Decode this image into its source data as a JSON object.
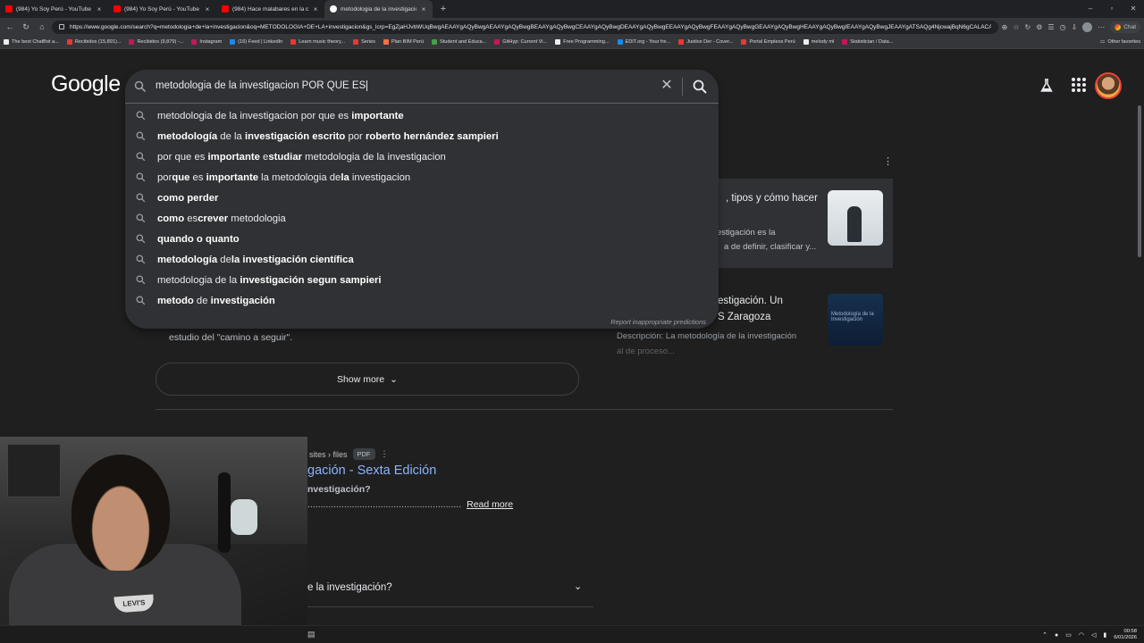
{
  "browser": {
    "tabs": [
      {
        "title": "(984) Yo Soy Perú - YouTube",
        "icon": "youtube-icon",
        "active": false
      },
      {
        "title": "(984) Yo Soy Perú - YouTube",
        "icon": "youtube-icon",
        "active": false
      },
      {
        "title": "(984) Hace malabares en la ca",
        "icon": "youtube-icon",
        "active": false
      },
      {
        "title": "metodologia de la investigacion",
        "icon": "google-icon",
        "active": true
      }
    ],
    "url": "https://www.google.com/search?q=metodologia+de+la+investigacion&oq=METODOLOGIA+DE+LA+investigacion&gs_lcrp=EgZjaHJvbWUqBwgAEAAYgAQyBwgAEAAYgAQyBwgBEAAYgAQyBwgCEAAYgAQyBwgDEAAYgAQyBwgEEAAYgAQyBwgFEAAYgAQyBwgGEAAYgAQyBwgHEAAYgAQyBwgIEAAYgAQyBwgJEAAYgATSAQg4NjcwajBqN6gCALACAA&sourceid=chrome&ie...",
    "chat_label": "Chat",
    "bookmarks": [
      "The best ChatBot a...",
      "Recibidos (15,891)...",
      "Recibidos (9,879) -...",
      "Instagram",
      "(16) Feed | LinkedIn",
      "Learn music theory...",
      "Series",
      "Plan BIM Perú",
      "Student and Educa...",
      "GitHyp: Current Vi...",
      "Free Programming...",
      "EDIT.org - Your fre...",
      "Justice Der - Cover...",
      "Portal Empleos Perú",
      "melody ml",
      "Statistician / Data..."
    ],
    "other_favorites": "Other favorites"
  },
  "google": {
    "logo": "Google",
    "search_value": "metodologia de la investigacion POR QUE ES",
    "suggestions": [
      [
        {
          "t": "metodologia de la investigacion por que es ",
          "b": false
        },
        {
          "t": "importante",
          "b": true
        }
      ],
      [
        {
          "t": "metodología",
          "b": true
        },
        {
          "t": " de la ",
          "b": false
        },
        {
          "t": "investigación",
          "b": true
        },
        {
          "t": " escrito",
          "b": true
        },
        {
          "t": " por ",
          "b": false
        },
        {
          "t": "roberto hernández sampieri",
          "b": true
        }
      ],
      [
        {
          "t": "por que es ",
          "b": false
        },
        {
          "t": "importante",
          "b": true
        },
        {
          "t": " e",
          "b": false
        },
        {
          "t": "studiar",
          "b": true
        },
        {
          "t": " metodologia de la investigacion",
          "b": false
        }
      ],
      [
        {
          "t": "por",
          "b": false
        },
        {
          "t": "que",
          "b": true
        },
        {
          "t": " es ",
          "b": false
        },
        {
          "t": "importante",
          "b": true
        },
        {
          "t": " la metodologia de",
          "b": false
        },
        {
          "t": "la",
          "b": true
        },
        {
          "t": " investigacion",
          "b": false
        }
      ],
      [
        {
          "t": "como perder",
          "b": true
        }
      ],
      [
        {
          "t": "como",
          "b": true
        },
        {
          "t": " es",
          "b": false
        },
        {
          "t": "crever",
          "b": true
        },
        {
          "t": " metodologia",
          "b": false
        }
      ],
      [
        {
          "t": "quando o quanto",
          "b": true
        }
      ],
      [
        {
          "t": "metodología",
          "b": true
        },
        {
          "t": " de",
          "b": false
        },
        {
          "t": "la investigación científica",
          "b": true
        }
      ],
      [
        {
          "t": "metodologia de la ",
          "b": false
        },
        {
          "t": "investigación segun sampieri",
          "b": true
        }
      ],
      [
        {
          "t": "metodo",
          "b": true
        },
        {
          "t": " de ",
          "b": false
        },
        {
          "t": "investigación",
          "b": true
        }
      ]
    ],
    "report_label": "Report inappropriate predictions"
  },
  "results": {
    "card1_title": ", tipos y cómo hacer",
    "card1_line1": "estigación es la",
    "card1_line2": "a de definir, clasificar y...",
    "card2_title": "estigación. Un",
    "card2_sub": "S Zaragoza",
    "card2_desc": "Descripción: La metodología de la investigación",
    "card2_desc2": "al de proceso...",
    "thumb2_text": "Metodología de la Investigación",
    "fragment": "estudio del \"camino a seguir\".",
    "show_more": "Show more",
    "site_crumb": "sites › files",
    "pdf_badge": "PDF",
    "result_title": "gación - Sexta Edición",
    "result_snip": "nvestigación?",
    "result_snip2": "...........................................................",
    "read_more": "Read more",
    "paa_question": "e la investigación?"
  },
  "taskbar": {
    "time": "00:58",
    "date": "6/01/2026"
  },
  "webcam": {
    "shirt_logo": "LEVI'S"
  }
}
